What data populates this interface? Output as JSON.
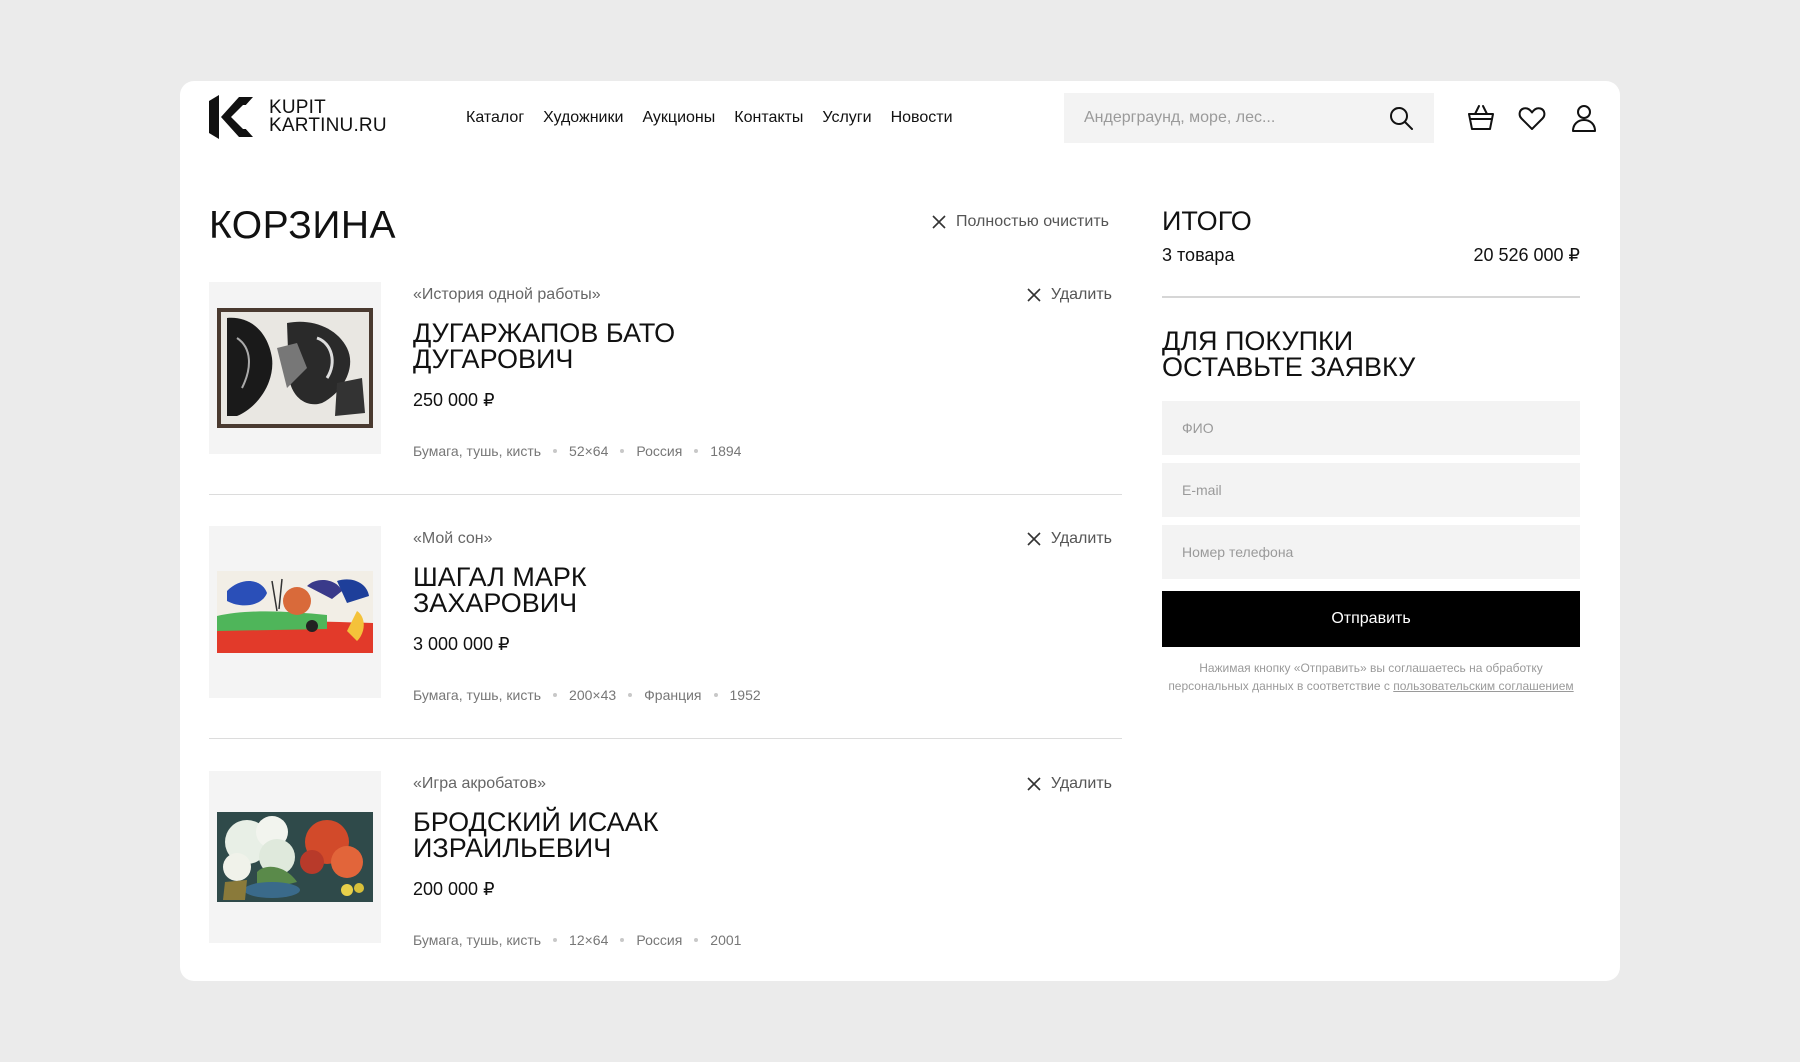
{
  "header": {
    "logo_line1": "KUPIT",
    "logo_line2": "KARTINU.RU",
    "nav": [
      "Каталог",
      "Художники",
      "Аукционы",
      "Контакты",
      "Услуги",
      "Новости"
    ],
    "search_placeholder": "Андерграунд, море, лес...",
    "icons": [
      "search-icon",
      "basket-icon",
      "heart-icon",
      "user-icon"
    ]
  },
  "cart": {
    "title": "КОРЗИНА",
    "clear_label": "Полностью очистить",
    "remove_label": "Удалить",
    "items": [
      {
        "work": "«История одной работы»",
        "artist_line1": "ДУГАРЖАПОВ БАТО",
        "artist_line2": "ДУГАРОВИЧ",
        "price": "250 000 ₽",
        "medium": "Бумага, тушь, кисть",
        "size": "52×64",
        "country": "Россия",
        "year": "1894"
      },
      {
        "work": "«Мой сон»",
        "artist_line1": "ШАГАЛ МАРК",
        "artist_line2": "ЗАХАРОВИЧ",
        "price": "3 000 000 ₽",
        "medium": "Бумага, тушь, кисть",
        "size": "200×43",
        "country": "Франция",
        "year": "1952"
      },
      {
        "work": "«Игра акробатов»",
        "artist_line1": "БРОДСКИЙ ИСААК",
        "artist_line2": "ИЗРАИЛЬЕВИЧ",
        "price": "200 000 ₽",
        "medium": "Бумага, тушь, кисть",
        "size": "12×64",
        "country": "Россия",
        "year": "2001"
      }
    ]
  },
  "summary": {
    "title": "ИТОГО",
    "count": "3 товара",
    "total": "20 526 000 ₽"
  },
  "request": {
    "title_line1": "ДЛЯ ПОКУПКИ",
    "title_line2": "ОСТАВЬТЕ ЗАЯВКУ",
    "name_placeholder": "ФИО",
    "email_placeholder": "E-mail",
    "phone_placeholder": "Номер телефона",
    "submit_label": "Отправить",
    "consent_text": "Нажимая кнопку «Отправить» вы соглашаетесь на обработку персональных данных в соответствие с",
    "consent_link": "пользовательским соглашением"
  }
}
